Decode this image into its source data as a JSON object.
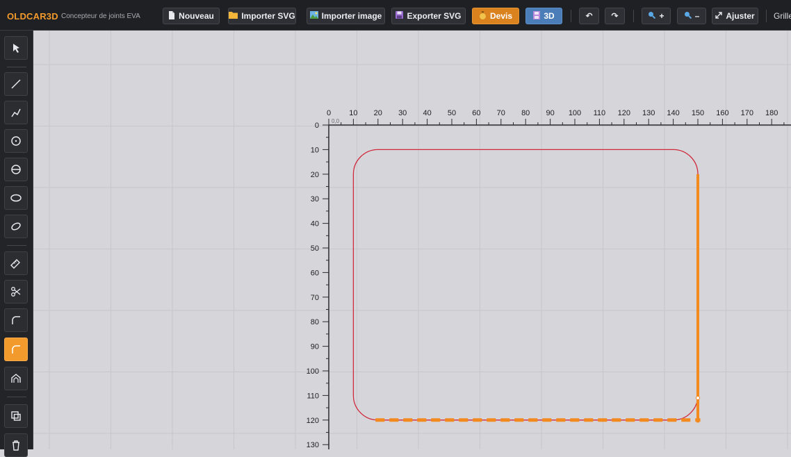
{
  "app": {
    "brand": "OLDCAR3D",
    "subtitle": "Concepteur de joints EVA"
  },
  "toolbar": {
    "nouveau_label": "Nouveau",
    "importer_svg_label": "Importer SVG",
    "importer_image_label": "Importer image",
    "exporter_svg_label": "Exporter SVG",
    "devis_label": "Devis",
    "view3d_label": "3D",
    "undo_glyph": "↶",
    "redo_glyph": "↷",
    "zoom_in_label": "+",
    "zoom_out_label": "–",
    "ajuster_label": "Ajuster",
    "grille_label": "Grille"
  },
  "tools": [
    {
      "name": "select-tool",
      "icon": "cursor-icon",
      "active": false
    },
    {
      "name": "line-tool",
      "icon": "line-icon",
      "active": false
    },
    {
      "name": "polyline-tool",
      "icon": "polyline-icon",
      "active": false
    },
    {
      "name": "circle-tool",
      "icon": "circle-icon",
      "active": false
    },
    {
      "name": "circle-diameter-tool",
      "icon": "circle-diameter-icon",
      "active": false
    },
    {
      "name": "ellipse-tool",
      "icon": "ellipse-icon",
      "active": false
    },
    {
      "name": "tilted-ellipse-tool",
      "icon": "tilted-ellipse-icon",
      "active": false
    },
    {
      "name": "measure-tool",
      "icon": "ruler-icon",
      "active": false
    },
    {
      "name": "cut-tool",
      "icon": "scissors-icon",
      "active": false
    },
    {
      "name": "fillet-tool",
      "icon": "corner-round-icon",
      "active": false
    },
    {
      "name": "fillet-active-tool",
      "icon": "corner-round-icon",
      "active": true
    },
    {
      "name": "arch-tool",
      "icon": "arch-icon",
      "active": false
    },
    {
      "name": "duplicate-tool",
      "icon": "duplicate-icon",
      "active": false
    },
    {
      "name": "delete-tool",
      "icon": "trash-icon",
      "active": false
    }
  ],
  "canvas": {
    "origin_label": "0,0",
    "x_ticks": [
      "0",
      "10",
      "20",
      "30",
      "40",
      "50",
      "60",
      "70",
      "80",
      "90",
      "100",
      "110",
      "120",
      "130",
      "140",
      "150",
      "160",
      "170",
      "180"
    ],
    "y_ticks": [
      "0",
      "10",
      "20",
      "30",
      "40",
      "50",
      "60",
      "70",
      "80",
      "90",
      "100",
      "110",
      "120",
      "130"
    ],
    "colors": {
      "shape": "#d0283c",
      "selection": "#f28a1e",
      "axis": "#2a2a2c",
      "grid": "#c6c6cb"
    },
    "shape": {
      "type": "rounded-rectangle",
      "x_min": 10,
      "y_min": 10,
      "x_max": 150,
      "y_max": 120,
      "corner_radius": 10
    },
    "selection": {
      "right_edge": {
        "x": 150,
        "y_from": 20,
        "y_to": 121
      },
      "bottom_edge_dashed": {
        "y": 120,
        "x_from": 19,
        "x_to": 151
      }
    }
  }
}
